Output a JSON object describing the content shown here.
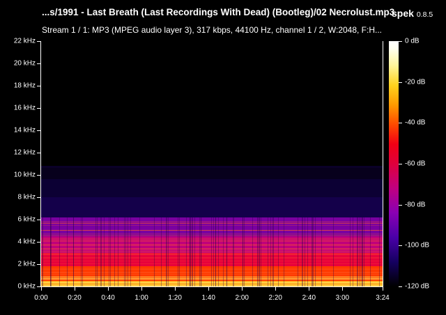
{
  "header": {
    "file_title": "...s/1991 - Last Breath (Last Recordings With Dead) (Bootleg)/02 Necrolust.mp3",
    "app_name": "spek",
    "app_version": "0.8.5",
    "stream_info": "Stream 1 / 1: MP3 (MPEG audio layer 3), 317 kbps, 44100 Hz, channel 1 / 2, W:2048, F:H..."
  },
  "frequency_axis": {
    "labels": [
      "22 kHz",
      "20 kHz",
      "18 kHz",
      "16 kHz",
      "14 kHz",
      "12 kHz",
      "10 kHz",
      "8 kHz",
      "6 kHz",
      "4 kHz",
      "2 kHz",
      "0 kHz"
    ],
    "values_khz": [
      22,
      20,
      18,
      16,
      14,
      12,
      10,
      8,
      6,
      4,
      2,
      0
    ],
    "range_khz": [
      0,
      22
    ]
  },
  "time_axis": {
    "labels": [
      "0:00",
      "0:20",
      "0:40",
      "1:00",
      "1:20",
      "1:40",
      "2:00",
      "2:20",
      "2:40",
      "3:00",
      "3:24"
    ],
    "values_s": [
      0,
      20,
      40,
      60,
      80,
      100,
      120,
      140,
      160,
      180,
      204
    ],
    "range_s": [
      0,
      204
    ]
  },
  "colorbar": {
    "labels": [
      "0 dB",
      "-20 dB",
      "-40 dB",
      "-60 dB",
      "-80 dB",
      "-100 dB",
      "-120 dB"
    ],
    "values_db": [
      0,
      -20,
      -40,
      -60,
      -80,
      -100,
      -120
    ],
    "range_db": [
      -120,
      0
    ]
  },
  "spectrum": {
    "cutoff_khz": 6.2,
    "faint_band_khz": 10.8,
    "bands": [
      {
        "from_khz": 0,
        "to_khz": 0.5,
        "color": "#ff9a10"
      },
      {
        "from_khz": 0.5,
        "to_khz": 1.8,
        "color": "#ff3a00"
      },
      {
        "from_khz": 1.8,
        "to_khz": 3.0,
        "color": "#e8003c"
      },
      {
        "from_khz": 3.0,
        "to_khz": 4.5,
        "color": "#c0007c"
      },
      {
        "from_khz": 4.5,
        "to_khz": 6.2,
        "color": "#7a00a0"
      },
      {
        "from_khz": 6.2,
        "to_khz": 8.0,
        "color": "#14004a"
      },
      {
        "from_khz": 8.0,
        "to_khz": 9.6,
        "color": "#0c0034"
      },
      {
        "from_khz": 9.6,
        "to_khz": 10.8,
        "color": "#07001c"
      }
    ]
  }
}
